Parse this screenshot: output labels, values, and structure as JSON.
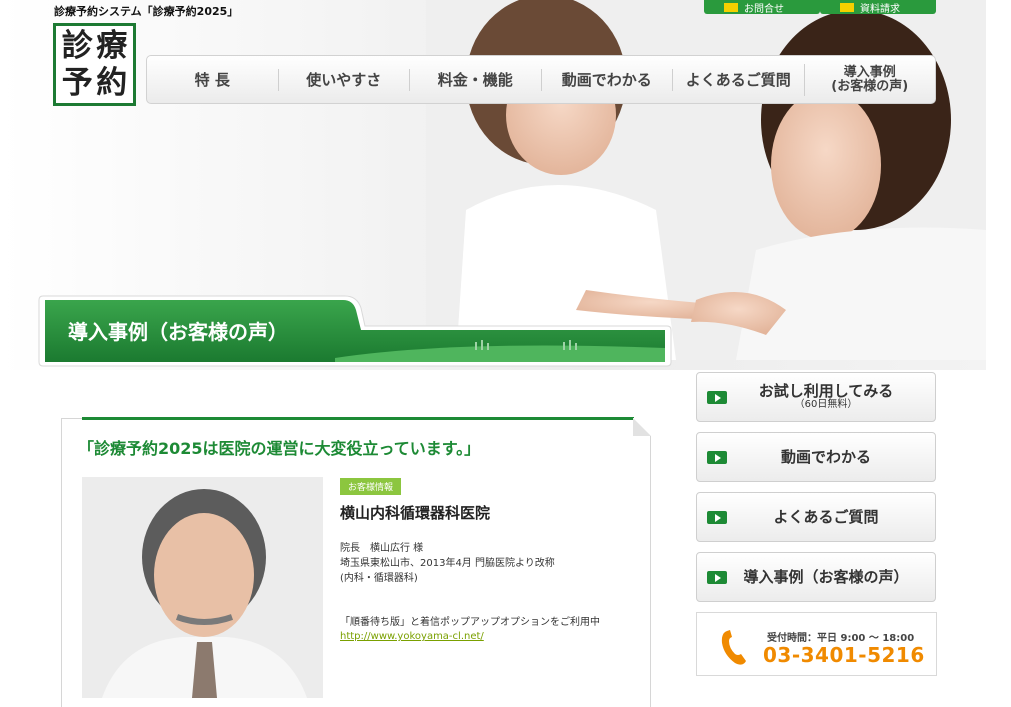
{
  "header": {
    "site_title": "診療予約システム「診療予約2025」",
    "logo_chars": [
      "診",
      "療",
      "予",
      "約"
    ],
    "top_buttons": [
      {
        "label": "お問合せ"
      },
      {
        "label": "資料請求"
      }
    ]
  },
  "global_nav": {
    "items": [
      {
        "label": "特 長"
      },
      {
        "label": "使いやすさ"
      },
      {
        "label": "料金・機能"
      },
      {
        "label": "動画でわかる"
      },
      {
        "label": "よくあるご質問"
      },
      {
        "label": "導入事例\n(お客様の声)"
      }
    ]
  },
  "page_banner": {
    "title": "導入事例（お客様の声）"
  },
  "case": {
    "quote": "「診療予約2025は医院の運営に大変役立っています。」",
    "tag": "お客様情報",
    "clinic_name": "横山内科循環器科医院",
    "info_lines": [
      "院長　横山広行 様",
      "埼玉県東松山市、2013年4月 門脇医院より改称",
      "(内科・循環器科)"
    ],
    "usage": "「順番待ち版」と着信ポップアップオプションをご利用中",
    "url": "http://www.yokoyama-cl.net/"
  },
  "side_menu": [
    {
      "label": "お試し利用してみる",
      "sub": "（60日無料）"
    },
    {
      "label": "動画でわかる",
      "sub": ""
    },
    {
      "label": "よくあるご質問",
      "sub": ""
    },
    {
      "label": "導入事例（お客様の声）",
      "sub": ""
    }
  ],
  "contact": {
    "hours": "受付時間：平日 9:00 ～ 18:00",
    "phone": "03-3401-5216"
  },
  "colors": {
    "brand_green": "#1d8a35",
    "accent_orange": "#f08a00",
    "tag_green": "#8cc63f"
  }
}
